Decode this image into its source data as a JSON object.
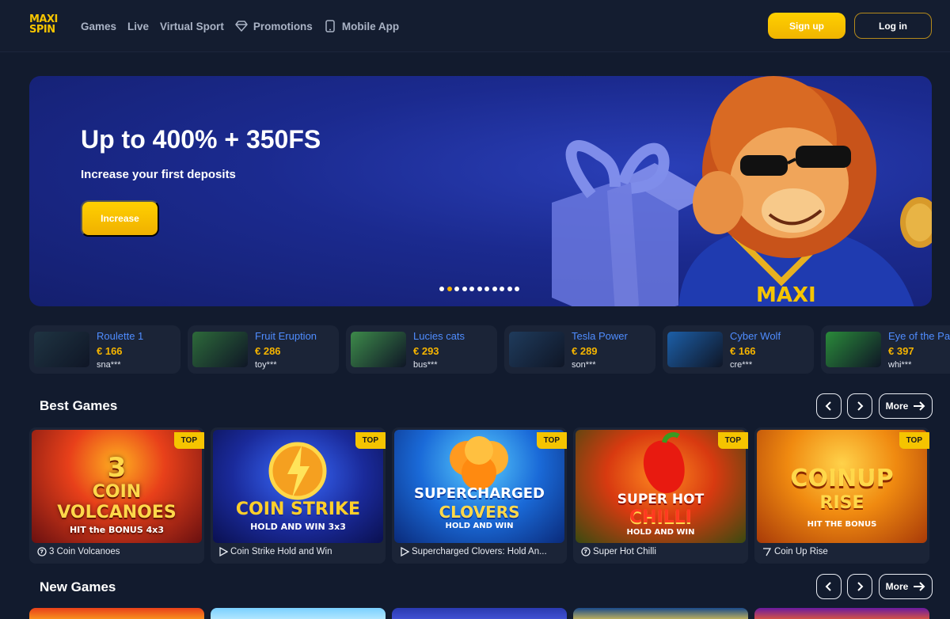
{
  "header": {
    "logo_line1": "MAXI",
    "logo_line2": "SPIN",
    "nav": [
      {
        "label": "Games",
        "icon": ""
      },
      {
        "label": "Live",
        "icon": ""
      },
      {
        "label": "Virtual Sport",
        "icon": ""
      },
      {
        "label": "Promotions",
        "icon": "diamond-icon"
      },
      {
        "label": "Mobile App",
        "icon": "phone-icon"
      }
    ],
    "signup_label": "Sign up",
    "login_label": "Log in"
  },
  "hero": {
    "title": "Up to 400% + 350FS",
    "subtitle": "Increase your first deposits",
    "button_label": "Increase",
    "slide_count": 11,
    "active_slide": 2,
    "mascot_text": "MAXI",
    "colors": {
      "accent": "#f5b400",
      "banner": "#1b2a8f"
    }
  },
  "winners": [
    {
      "game": "Roulette 1",
      "amount": "€ 166",
      "user": "sna***",
      "thumb_color": "#1f3442"
    },
    {
      "game": "Fruit Eruption",
      "amount": "€ 286",
      "user": "toy***",
      "thumb_color": "#2d6a3a"
    },
    {
      "game": "Lucies cats",
      "amount": "€ 293",
      "user": "bus***",
      "thumb_color": "#3d8a4a"
    },
    {
      "game": "Tesla Power",
      "amount": "€ 289",
      "user": "son***",
      "thumb_color": "#1f3b5c"
    },
    {
      "game": "Cyber Wolf",
      "amount": "€ 166",
      "user": "cre***",
      "thumb_color": "#1c5fa8"
    },
    {
      "game": "Eye of the Panda",
      "amount": "€ 397",
      "user": "whi***",
      "thumb_color": "#2a8a3a"
    }
  ],
  "best_games": {
    "title": "Best Games",
    "prev_icon": "chevron-left-icon",
    "next_icon": "chevron-right-icon",
    "more_label": "More",
    "items": [
      {
        "title": "3 Coin Volcanoes",
        "badge": "TOP",
        "art_line1": "3",
        "art_line2": "COIN",
        "art_line3": "VOLCANOES",
        "art_line4": "HIT the BONUS 4x3",
        "icon": "coin-icon"
      },
      {
        "title": "Coin Strike Hold and Win",
        "badge": "TOP",
        "art_line1": "COIN STRIKE",
        "art_line2": "HOLD AND WIN 3x3",
        "icon": "play-icon"
      },
      {
        "title": "Supercharged Clovers: Hold An...",
        "badge": "TOP",
        "art_line1": "SUPERCHARGED",
        "art_line2": "CLOVERS",
        "art_line3": "HOLD AND WIN",
        "icon": "play-icon"
      },
      {
        "title": "Super Hot Chilli",
        "badge": "TOP",
        "art_line1": "SUPER HOT",
        "art_line2": "CHILLI",
        "art_line3": "HOLD AND WIN",
        "icon": "coin-icon"
      },
      {
        "title": "Coin Up Rise",
        "badge": "TOP",
        "art_line1": "COINUP",
        "art_line2": "RISE",
        "art_line3": "HIT THE BONUS",
        "icon": "slot-icon"
      }
    ]
  },
  "new_games": {
    "title": "New Games",
    "more_label": "More"
  }
}
